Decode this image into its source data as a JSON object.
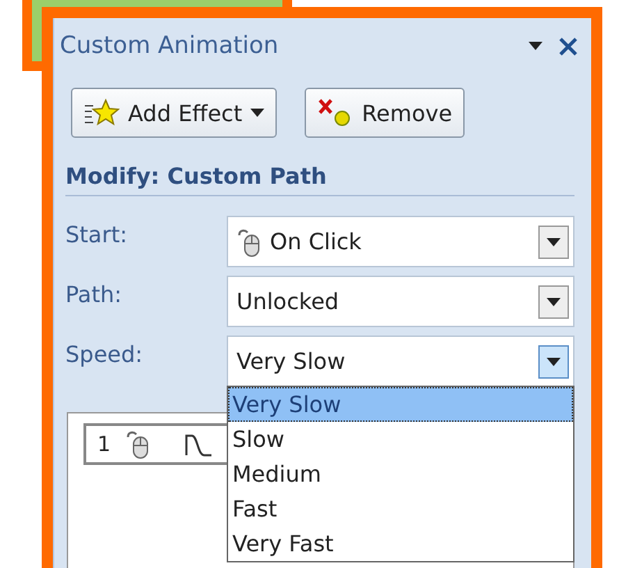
{
  "task_pane": {
    "title": "Custom Animation",
    "buttons": [
      {
        "label": "Add Effect",
        "kind": "add"
      },
      {
        "label": "Remove",
        "kind": "remove"
      }
    ],
    "section": "Modify: Custom Path",
    "fields": [
      {
        "label": "Start:",
        "value": "On Click",
        "kind": "click",
        "open": false
      },
      {
        "label": "Path:",
        "value": "Unlocked",
        "kind": "plain",
        "open": false
      },
      {
        "label": "Speed:",
        "value": "Very Slow",
        "kind": "plain",
        "open": true
      }
    ],
    "speed_options": [
      {
        "label": "Very Slow",
        "selected": true
      },
      {
        "label": "Slow",
        "selected": false
      },
      {
        "label": "Medium",
        "selected": false
      },
      {
        "label": "Fast",
        "selected": false
      },
      {
        "label": "Very Fast",
        "selected": false
      }
    ],
    "animation_list": [
      {
        "number": "1"
      }
    ]
  }
}
